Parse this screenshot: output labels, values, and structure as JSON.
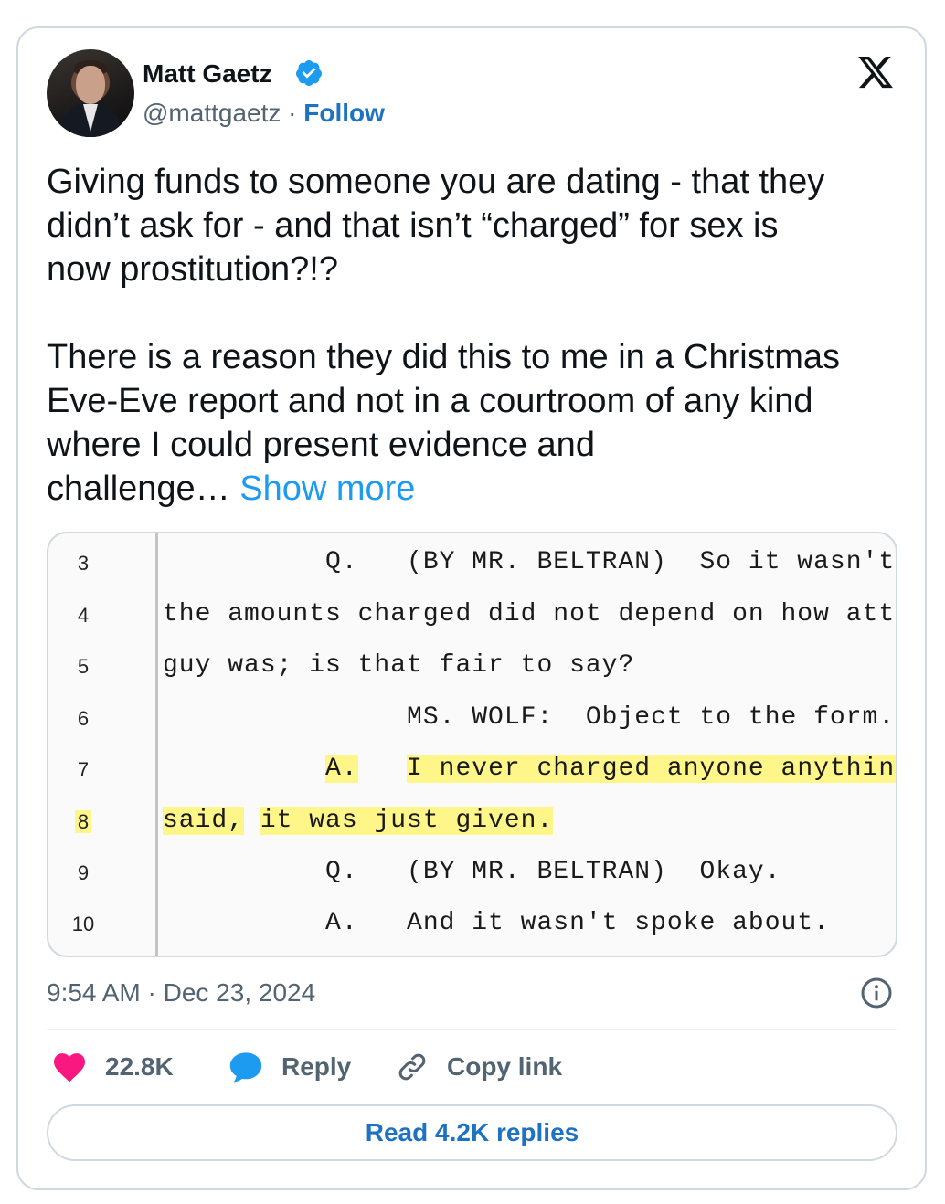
{
  "author": {
    "name": "Matt Gaetz",
    "handle": "@mattgaetz",
    "separator": " · ",
    "follow_label": "Follow",
    "verified_icon": "verified-badge-icon"
  },
  "platform_icon": "x-logo-icon",
  "tweet": {
    "paragraph1": "Giving funds to someone you are dating - that they\ndidn’t ask for - and that isn’t “charged” for sex is\nnow prostitution?!?",
    "paragraph2": "There is a reason they did this to me in a Christmas\nEve-Eve report and not in a courtroom of any kind\nwhere I could present evidence and\nchallenge… ",
    "show_more": "Show more"
  },
  "media": {
    "transcript_lines": [
      {
        "num": "3",
        "text": "          Q.   (BY MR. BELTRAN)  So it wasn't that"
      },
      {
        "num": "4",
        "text": "the amounts charged did not depend on how attractive the"
      },
      {
        "num": "5",
        "text": "guy was; is that fair to say?"
      },
      {
        "num": "6",
        "text": "               MS. WOLF:  Object to the form."
      },
      {
        "num": "7",
        "pre": "          ",
        "hl1": "A.",
        "gap": "   ",
        "hl2": "I never charged anyone anything."
      },
      {
        "num": "8",
        "hl1": "said,",
        "gap": " ",
        "hl2": "it was just given."
      },
      {
        "num": "9",
        "text": "          Q.   (BY MR. BELTRAN)  Okay."
      },
      {
        "num": "10",
        "text": "          A.   And it wasn't spoke about."
      }
    ]
  },
  "meta": {
    "timestamp": "9:54 AM · Dec 23, 2024",
    "info_icon": "info-icon"
  },
  "actions": {
    "like_count": "22.8K",
    "reply_label": "Reply",
    "copy_link_label": "Copy link"
  },
  "read_replies_label": "Read 4.2K replies",
  "colors": {
    "text": "#0f1419",
    "secondary": "#536471",
    "link": "#1d9bf0",
    "follow": "#1d72c2",
    "like": "#f91880",
    "reply": "#1d9bf0",
    "highlight": "#fff68a"
  }
}
